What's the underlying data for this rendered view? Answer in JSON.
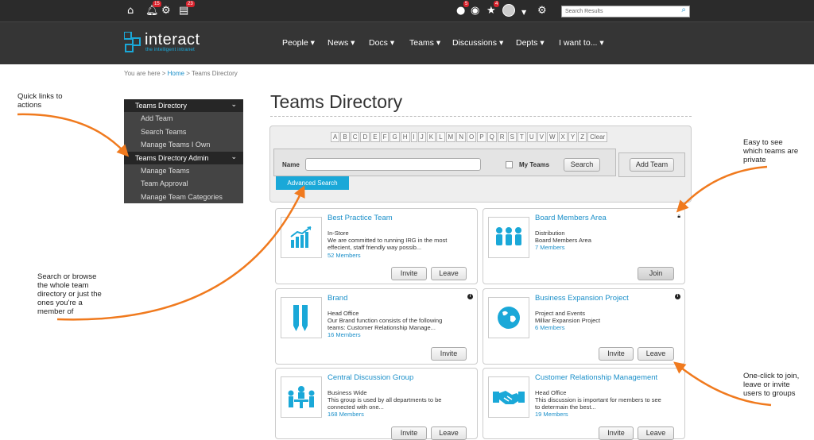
{
  "topbar": {
    "notifications_badge": "15",
    "tasks_badge": "23",
    "alerts_badge": "5",
    "favorites_badge": "4",
    "search_placeholder": "Search Results",
    "icons": [
      "home-icon",
      "bell-icon",
      "gear-icon",
      "tasks-icon",
      "alert-icon",
      "eye-icon",
      "star-icon",
      "avatar",
      "settings-icon",
      "search-icon"
    ]
  },
  "brand": {
    "name": "interact",
    "tagline": "the intelligent intranet",
    "accent": "#1aa8d8"
  },
  "nav": [
    {
      "label": "People"
    },
    {
      "label": "News"
    },
    {
      "label": "Docs"
    },
    {
      "label": "Teams"
    },
    {
      "label": "Discussions"
    },
    {
      "label": "Depts"
    },
    {
      "label": "I want to..."
    }
  ],
  "breadcrumb": {
    "prefix": "You are here >",
    "home": "Home",
    "sep": ">",
    "current": "Teams Directory"
  },
  "sidebar": {
    "section1": {
      "title": "Teams Directory",
      "items": [
        "Add Team",
        "Search Teams",
        "Manage Teams I Own"
      ]
    },
    "section2": {
      "title": "Teams Directory Admin",
      "items": [
        "Manage Teams",
        "Team Approval",
        "Manage Team Categories"
      ]
    }
  },
  "page": {
    "title": "Teams Directory"
  },
  "search": {
    "letters": [
      "A",
      "B",
      "C",
      "D",
      "E",
      "F",
      "G",
      "H",
      "I",
      "J",
      "K",
      "L",
      "M",
      "N",
      "O",
      "P",
      "Q",
      "R",
      "S",
      "T",
      "U",
      "V",
      "W",
      "X",
      "Y",
      "Z",
      "Clear"
    ],
    "name_label": "Name",
    "name_value": "",
    "my_teams_label": "My Teams",
    "search_button": "Search",
    "add_team_button": "Add Team",
    "advanced_search": "Advanced Search"
  },
  "teams": [
    {
      "title": "Best Practice Team",
      "category": "In-Store",
      "description": "We are committed to running IRG in the most effecient, staff friendly way possib...",
      "members": "52 Members",
      "icon": "chart-growth-icon",
      "buttons": [
        "Invite",
        "Leave"
      ]
    },
    {
      "title": "Board Members Area",
      "category": "Distribution",
      "description": "Board Members Area",
      "members": "7 Members",
      "icon": "people-group-icon",
      "buttons": [
        "Join"
      ],
      "private": true
    },
    {
      "title": "Brand",
      "category": "Head Office",
      "description": "Our Brand function consists of the following teams: Customer Relationship Manage...",
      "members": "16 Members",
      "icon": "pencils-icon",
      "buttons": [
        "Invite"
      ]
    },
    {
      "title": "Business Expansion Project",
      "category": "Project and Events",
      "description": "Milliar Expansion Project",
      "members": "6 Members",
      "icon": "globe-icon",
      "buttons": [
        "Invite",
        "Leave"
      ]
    },
    {
      "title": "Central Discussion Group",
      "category": "Business Wide",
      "description": "This group is used by all departments to be connected with one...",
      "members": "168 Members",
      "icon": "meeting-icon",
      "buttons": [
        "Invite",
        "Leave"
      ]
    },
    {
      "title": "Customer Relationship Management",
      "category": "Head Office",
      "description": "This discussion is important for members to see to determain the best...",
      "members": "19 Members",
      "icon": "handshake-icon",
      "buttons": [
        "Invite",
        "Leave"
      ]
    }
  ],
  "annotations": {
    "quick_links": "Quick links to actions",
    "search_browse": "Search or browse the whole team directory or just the ones you're a member of",
    "private": "Easy to see which teams are private",
    "one_click": "One-click to join, leave or invite users to groups"
  },
  "colors": {
    "accent": "#1aa8d8",
    "link": "#1a8fc9",
    "arrow": "#f07a1e",
    "topbar": "#2b2b2b",
    "navbar": "#353535"
  }
}
